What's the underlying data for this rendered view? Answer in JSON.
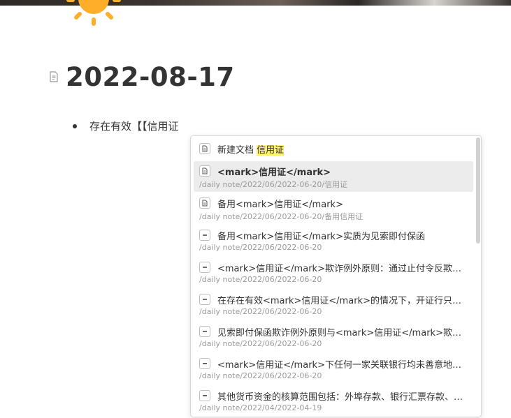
{
  "page": {
    "title": "2022-08-17",
    "bullet_text": "存在有效【【信用证"
  },
  "popup": {
    "items": [
      {
        "prefix": "新建文档 ",
        "highlight": "信用证",
        "icon": "page-icon",
        "path": ""
      },
      {
        "label": "<mark>信用证</mark>",
        "icon": "page-icon",
        "path": "/daily note/2022/06/2022-06-20/信用证"
      },
      {
        "label": "备用<mark>信用证</mark>",
        "icon": "page-icon",
        "path": "/daily note/2022/06/2022-06-20/备用信用证"
      },
      {
        "label": "备用<mark>信用证</mark>实质为见索即付保函",
        "icon": "block-icon",
        "path": "/daily note/2022/06/2022-06-20"
      },
      {
        "label": "<mark>信用证</mark>欺诈例外原则：通过止付令反欺诈的法律机制",
        "icon": "block-icon",
        "path": "/daily note/2022/06/2022-06-20"
      },
      {
        "label": "在存在有效<mark>信用证</mark>的情况下，开证行只有在单证相符时才付款",
        "icon": "block-icon",
        "path": "/daily note/2022/06/2022-06-20"
      },
      {
        "label": "见索即付保函欺诈例外原则与<mark>信用证</mark>欺诈例外原则的异同",
        "icon": "block-icon",
        "path": "/daily note/2022/06/2022-06-20"
      },
      {
        "label": "<mark>信用证</mark>下任何一家关联银行均未善意地付款或承兑",
        "icon": "block-icon",
        "path": "/daily note/2022/06/2022-06-20"
      },
      {
        "label": "其他货币资金的核算范围包括：外埠存款、银行汇票存款、银行本票存款",
        "icon": "block-icon",
        "path": "/daily note/2022/04/2022-04-19"
      }
    ]
  },
  "colors": {
    "title": "#333333",
    "highlight": "#fff170",
    "selected_row": "#ececec",
    "path_text": "#9a9a9a",
    "sun": "#ffae2a"
  }
}
